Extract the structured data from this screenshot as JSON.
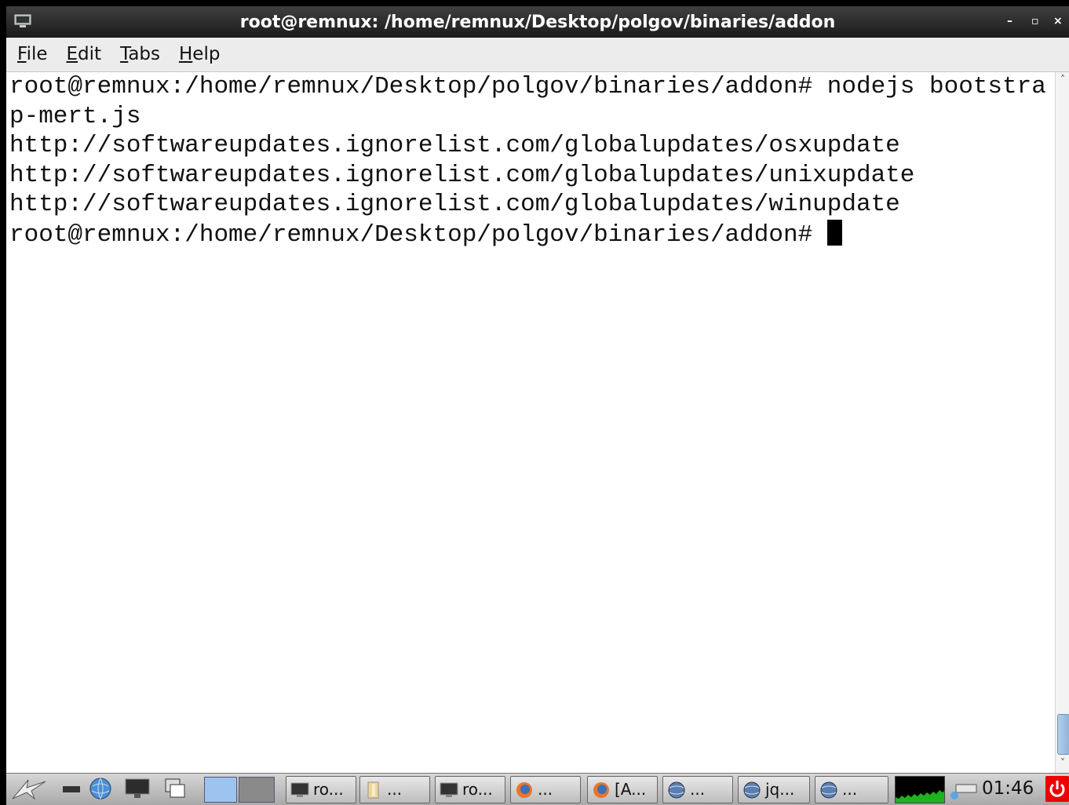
{
  "window": {
    "title": "root@remnux: /home/remnux/Desktop/polgov/binaries/addon",
    "controls": {
      "minimize": "–",
      "maximize": "▫",
      "close": "×"
    }
  },
  "menu": {
    "items": [
      {
        "mnemonic": "F",
        "rest": "ile"
      },
      {
        "mnemonic": "E",
        "rest": "dit"
      },
      {
        "mnemonic": "T",
        "rest": "abs"
      },
      {
        "mnemonic": "H",
        "rest": "elp"
      }
    ]
  },
  "terminal": {
    "lines": [
      "root@remnux:/home/remnux/Desktop/polgov/binaries/addon# nodejs bootstra",
      "p-mert.js",
      "http://softwareupdates.ignorelist.com/globalupdates/osxupdate",
      "http://softwareupdates.ignorelist.com/globalupdates/unixupdate",
      "http://softwareupdates.ignorelist.com/globalupdates/winupdate"
    ],
    "prompt": "root@remnux:/home/remnux/Desktop/polgov/binaries/addon# "
  },
  "taskbar": {
    "tasks": [
      {
        "label": "ro...",
        "icon": "terminal-icon"
      },
      {
        "label": "...",
        "icon": "folder-icon"
      },
      {
        "label": "ro...",
        "icon": "terminal-icon"
      },
      {
        "label": "...",
        "icon": "firefox-icon"
      },
      {
        "label": "[A...",
        "icon": "firefox-icon"
      },
      {
        "label": "...",
        "icon": "globe-icon"
      },
      {
        "label": "jq...",
        "icon": "globe-icon"
      },
      {
        "label": "...",
        "icon": "globe-icon"
      }
    ],
    "clock": "01:46"
  },
  "colors": {
    "titlebar": "#262626",
    "terminal_bg": "#ffffff",
    "terminal_fg": "#111111",
    "scroll_thumb": "#8fb5da",
    "power": "#e00000",
    "monitor_graph": "#1db31d"
  }
}
